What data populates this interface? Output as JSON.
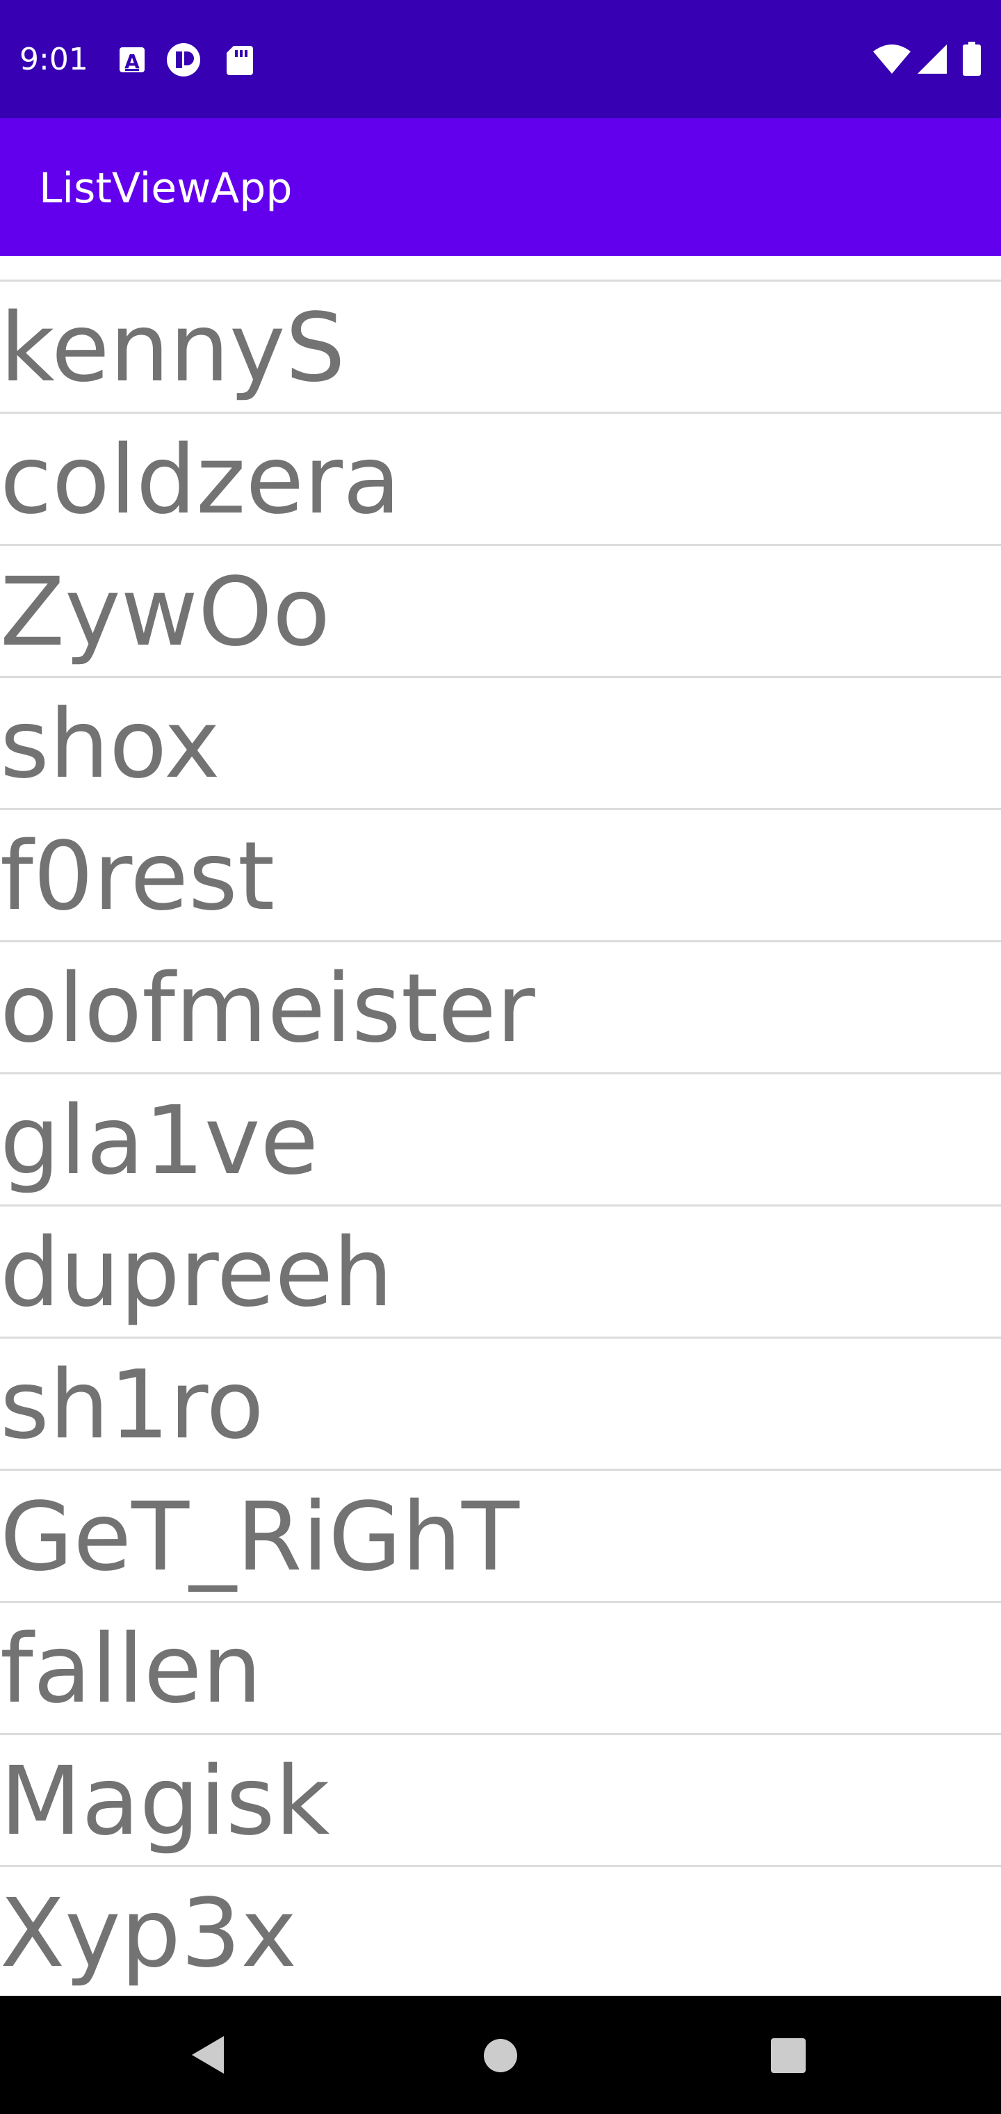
{
  "status_bar": {
    "time": "9:01",
    "icons_left": [
      "text-a-icon",
      "pocket-icon",
      "sd-card-icon"
    ],
    "icons_right": [
      "wifi-icon",
      "cell-signal-icon",
      "battery-icon"
    ]
  },
  "app_bar": {
    "title": "ListViewApp",
    "color": "#6200EE",
    "status_color": "#3700B3"
  },
  "list": {
    "text_color": "#737373",
    "items": [
      "kennyS",
      "coldzera",
      "ZywOo",
      "shox",
      "f0rest",
      "olofmeister",
      "gla1ve",
      "dupreeh",
      "sh1ro",
      "GeT_RiGhT",
      "fallen",
      "Magisk",
      "Xyp3x"
    ]
  },
  "nav_bar": {
    "buttons": [
      "back-icon",
      "home-icon",
      "recents-icon"
    ]
  }
}
